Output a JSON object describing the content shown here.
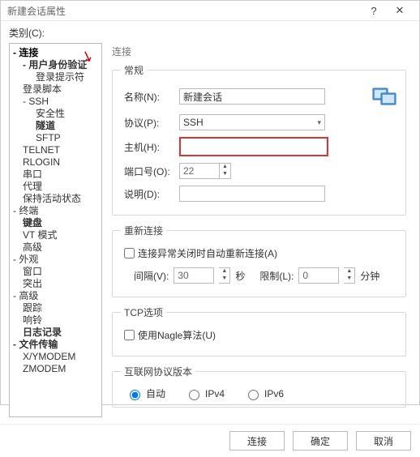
{
  "window": {
    "title": "新建会话属性"
  },
  "category_label": "类别(C):",
  "tree": {
    "items": [
      {
        "label": "连接",
        "indent": 0,
        "bold": true,
        "sel": true,
        "exp": "-"
      },
      {
        "label": "用户身份验证",
        "indent": 1,
        "bold": true,
        "exp": "-"
      },
      {
        "label": "登录提示符",
        "indent": 2
      },
      {
        "label": "登录脚本",
        "indent": 1
      },
      {
        "label": "SSH",
        "indent": 1,
        "exp": "-"
      },
      {
        "label": "安全性",
        "indent": 2
      },
      {
        "label": "隧道",
        "indent": 2,
        "bold": true
      },
      {
        "label": "SFTP",
        "indent": 2
      },
      {
        "label": "TELNET",
        "indent": 1
      },
      {
        "label": "RLOGIN",
        "indent": 1
      },
      {
        "label": "串口",
        "indent": 1
      },
      {
        "label": "代理",
        "indent": 1
      },
      {
        "label": "保持活动状态",
        "indent": 1
      },
      {
        "label": "终端",
        "indent": 0,
        "exp": "-"
      },
      {
        "label": "键盘",
        "indent": 1,
        "bold": true
      },
      {
        "label": "VT 模式",
        "indent": 1
      },
      {
        "label": "高级",
        "indent": 1
      },
      {
        "label": "外观",
        "indent": 0,
        "exp": "-"
      },
      {
        "label": "窗口",
        "indent": 1
      },
      {
        "label": "突出",
        "indent": 1
      },
      {
        "label": "高级",
        "indent": 0,
        "exp": "-"
      },
      {
        "label": "跟踪",
        "indent": 1
      },
      {
        "label": "响铃",
        "indent": 1
      },
      {
        "label": "日志记录",
        "indent": 1,
        "bold": true
      },
      {
        "label": "文件传输",
        "indent": 0,
        "bold": true,
        "exp": "-"
      },
      {
        "label": "X/YMODEM",
        "indent": 1
      },
      {
        "label": "ZMODEM",
        "indent": 1
      }
    ]
  },
  "main": {
    "heading": "连接",
    "general": {
      "legend": "常规",
      "name_label": "名称(N):",
      "name_value": "新建会话",
      "protocol_label": "协议(P):",
      "protocol_value": "SSH",
      "host_label": "主机(H):",
      "host_value": "",
      "port_label": "端口号(O):",
      "port_value": "22",
      "desc_label": "说明(D):",
      "desc_value": ""
    },
    "reconnect": {
      "legend": "重新连接",
      "auto_label": "连接异常关闭时自动重新连接(A)",
      "interval_label": "间隔(V):",
      "interval_value": "30",
      "interval_unit": "秒",
      "limit_label": "限制(L):",
      "limit_value": "0",
      "limit_unit": "分钟"
    },
    "tcp": {
      "legend": "TCP选项",
      "nagle_label": "使用Nagle算法(U)"
    },
    "ipver": {
      "legend": "互联网协议版本",
      "auto": "自动",
      "ipv4": "IPv4",
      "ipv6": "IPv6"
    }
  },
  "footer": {
    "connect": "连接",
    "ok": "确定",
    "cancel": "取消"
  }
}
